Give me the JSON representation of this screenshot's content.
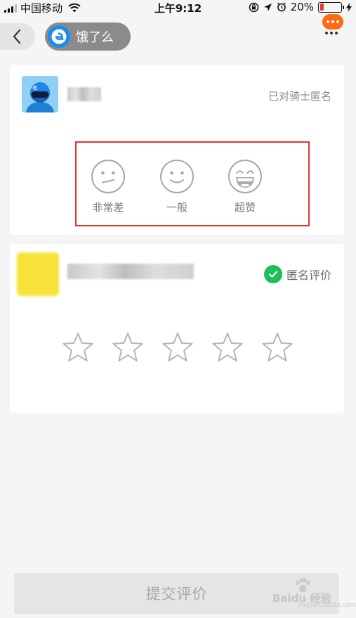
{
  "status_bar": {
    "carrier": "中国移动",
    "time": "上午9:12",
    "battery_percent": "20%",
    "battery_level": 0.2,
    "battery_color": "#e63939"
  },
  "nav": {
    "back_icon": "chevron-left-icon",
    "app_name": "饿了么",
    "app_logo_icon": "eleme-logo-icon",
    "more_icon": "more-dots-icon",
    "more_color": "#ff6a13"
  },
  "rider_card": {
    "anonymous_label": "已对骑士匿名",
    "ratings": [
      {
        "label": "非常差",
        "icon": "frown-face-icon"
      },
      {
        "label": "一般",
        "icon": "smile-face-icon"
      },
      {
        "label": "超赞",
        "icon": "laugh-face-icon"
      }
    ],
    "highlight_color": "#e8312b"
  },
  "shop_card": {
    "anonymous_label": "匿名评价",
    "anonymous_checked": true,
    "check_color": "#1fbf58",
    "star_count": 5,
    "rating": 0
  },
  "submit": {
    "label": "提交评价"
  },
  "watermark": {
    "text": "Baidu 经验",
    "url": "jingyan.baidu.com"
  }
}
